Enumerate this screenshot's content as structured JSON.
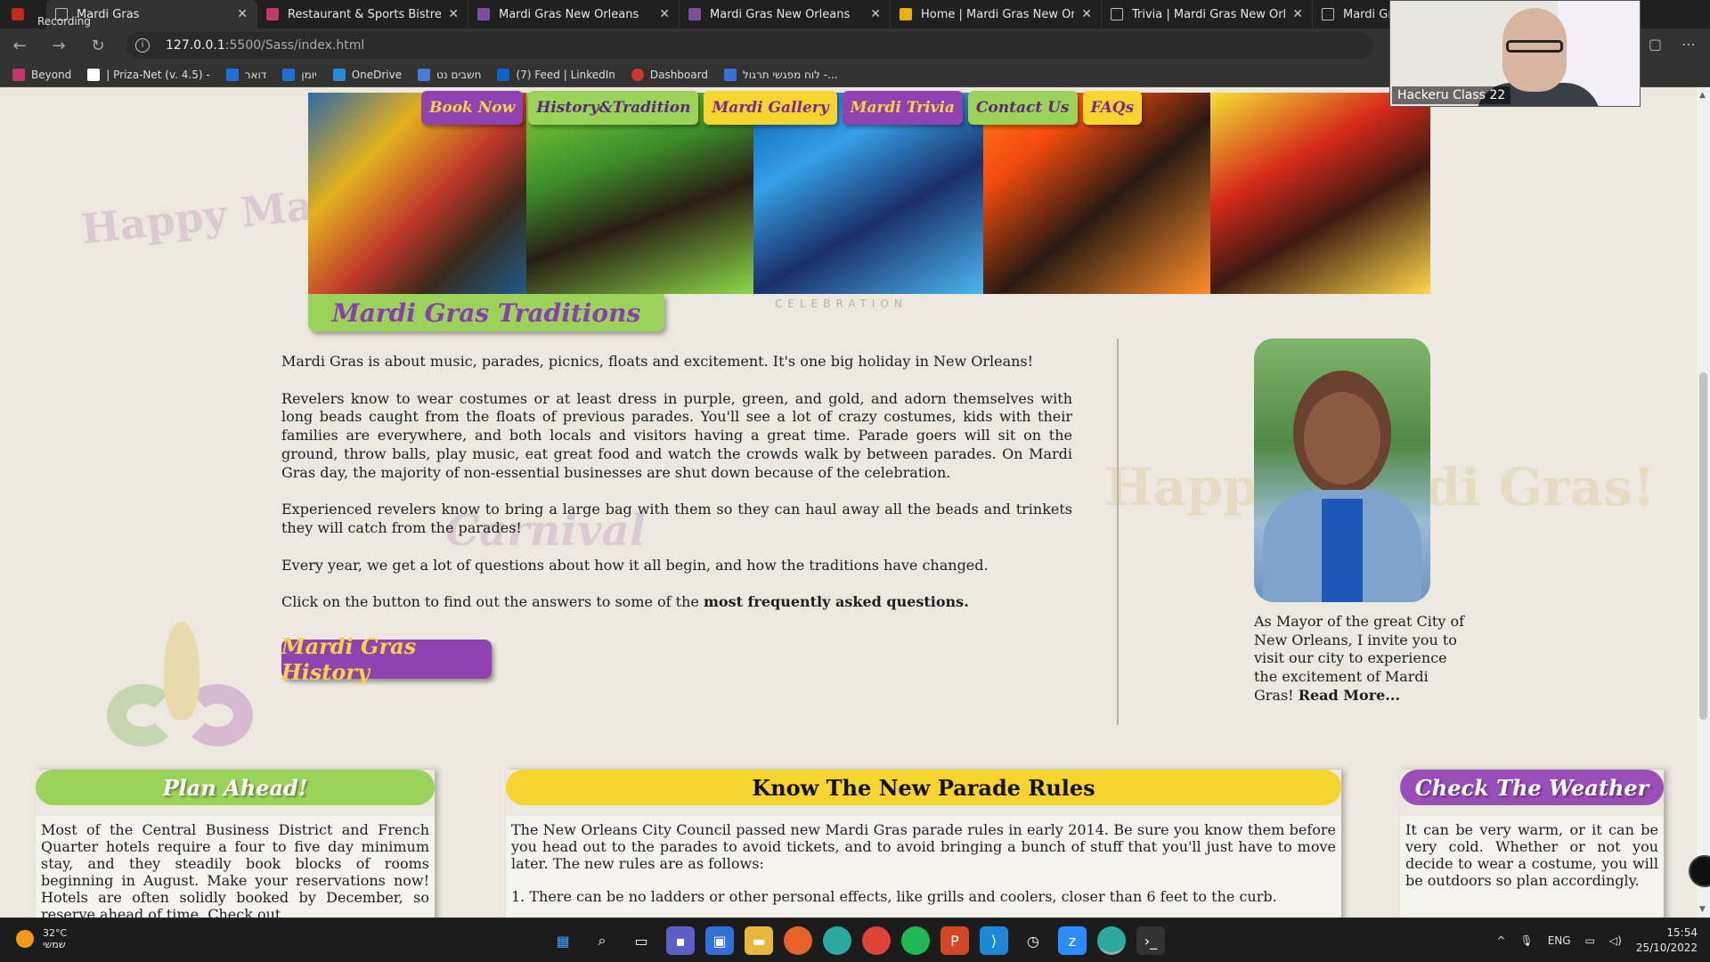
{
  "recording": "Recording",
  "tabs": [
    {
      "title": "Mardi Gras",
      "icon": "page-icon",
      "active": true
    },
    {
      "title": "Restaurant & Sports Bistreaux | V",
      "icon": "pink-site-icon"
    },
    {
      "title": "Mardi Gras New Orleans",
      "icon": "purple-mask-icon"
    },
    {
      "title": "Mardi Gras New Orleans",
      "icon": "purple-mask-icon"
    },
    {
      "title": "Home | Mardi Gras New Orleans",
      "icon": "yellow-feather-icon"
    },
    {
      "title": "Trivia | Mardi Gras New Orleans",
      "icon": "page-icon"
    },
    {
      "title": "Mardi Gra",
      "icon": "page-icon"
    }
  ],
  "address": {
    "host": "127.0.0.1",
    "rest": ":5500/Sass/index.html"
  },
  "bookmarks": [
    {
      "label": "Beyond",
      "color": "#c2376b"
    },
    {
      "label": "| Priza-Net (v. 4.5) -",
      "color": "#ffffff"
    },
    {
      "label": "דואר",
      "color": "#1f6fd6"
    },
    {
      "label": "יומן",
      "color": "#1f6fd6"
    },
    {
      "label": "OneDrive",
      "color": "#2b88d8"
    },
    {
      "label": "חשבים נט",
      "color": "#4a7bd0"
    },
    {
      "label": "(7) Feed | LinkedIn",
      "color": "#0a66c2"
    },
    {
      "label": "Dashboard",
      "color": "#d0342c"
    },
    {
      "label": "לוח מפגשי תרגול -...",
      "color": "#3b6fd8"
    }
  ],
  "webcam": {
    "label": "Hackeru Class 22"
  },
  "nav": [
    {
      "label": "Book Now",
      "style": "purple"
    },
    {
      "label": "History&Tradition",
      "style": "green"
    },
    {
      "label": "Mardi Gallery",
      "style": "yellow"
    },
    {
      "label": "Mardi Trivia",
      "style": "purple"
    },
    {
      "label": "Contact Us",
      "style": "green"
    },
    {
      "label": "FAQs",
      "style": "yellow"
    }
  ],
  "traditions": {
    "heading": "Mardi Gras Traditions",
    "paragraphs": [
      "Mardi Gras is about music, parades, picnics, floats and excitement. It's one big holiday in New Orleans!",
      "Revelers know to wear costumes or at least dress in purple, green, and gold, and adorn themselves with long beads caught from the floats of previous parades. You'll see a lot of crazy costumes, kids with their families are everywhere, and both locals and visitors having a great time. Parade goers will sit on the ground, throw balls, play music, eat great food and watch the crowds walk by between parades. On Mardi Gras day, the majority of non-essential businesses are shut down because of the celebration.",
      "Experienced revelers know to bring a large bag with them so they can haul away all the beads and trinkets they will catch from the parades!",
      "Every year, we get a lot of questions about how it all begin, and how the traditions have changed."
    ],
    "cta_prefix": "Click on the button to find out the answers to some of the ",
    "cta_bold": "most frequently asked questions.",
    "button": "Mardi Gras History"
  },
  "mayor": {
    "text": "As Mayor of the great City of New Orleans, I invite you to visit our city to experience the excitement of Mardi Gras! ",
    "link": "Read More..."
  },
  "boxes": {
    "plan": {
      "title": "Plan Ahead!",
      "text": "Most of the Central Business District and French Quarter hotels require a four to five day minimum stay, and they steadily book blocks of rooms beginning in August. Make your reservations now! Hotels are often solidly booked by December, so reserve ahead of time. Check out"
    },
    "rules": {
      "title": "Know The New Parade Rules",
      "intro": "The New Orleans City Council passed new Mardi Gras parade rules in early 2014. Be sure you know them before you head out to the parades to avoid tickets, and to avoid bringing a bunch of stuff that you'll just have to move later. The new rules are as follows:",
      "rule1": "1. There can be no ladders or other personal effects, like grills and coolers, closer than 6 feet to the curb."
    },
    "weather": {
      "title": "Check The Weather",
      "text": "It can be very warm, or it can be very cold. Whether or not you decide to wear a costume, you will be outdoors so plan accordingly."
    }
  },
  "watermarks": {
    "happy": "Happy Mardi Gras!",
    "carnival": "Carnival",
    "celebration": "CELEBRATION"
  },
  "taskbar": {
    "temp": "32°C",
    "weather_desc": "שמשי",
    "lang": "ENG",
    "time": "15:54",
    "date": "25/10/2022"
  }
}
